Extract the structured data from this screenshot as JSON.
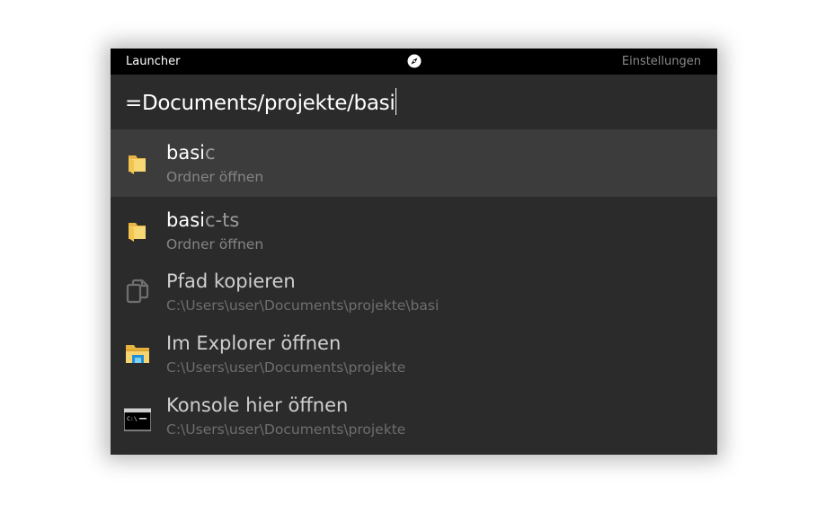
{
  "window": {
    "title": "Launcher",
    "settings_label": "Einstellungen",
    "center_icon": "compass-icon"
  },
  "search": {
    "query": "=Documents/projekte/basi"
  },
  "results": [
    {
      "icon": "folder-icon",
      "title_match": "basi",
      "title_rest": "c",
      "subtitle": "Ordner öffnen",
      "selected": true
    },
    {
      "icon": "folder-icon",
      "title_match": "basi",
      "title_rest": "c-ts",
      "subtitle": "Ordner öffnen",
      "selected": false
    },
    {
      "icon": "copy-icon",
      "title": "Pfad kopieren",
      "subtitle": "C:\\Users\\user\\Documents\\projekte\\basi",
      "selected": false
    },
    {
      "icon": "file-explorer-icon",
      "title": "Im Explorer öffnen",
      "subtitle": "C:\\Users\\user\\Documents\\projekte",
      "selected": false
    },
    {
      "icon": "console-icon",
      "title": "Konsole hier öffnen",
      "subtitle": "C:\\Users\\user\\Documents\\projekte",
      "selected": false
    }
  ],
  "colors": {
    "background": "#2b2b2b",
    "titlebar": "#000000",
    "selected_row": "#3c3c3c",
    "folder_yellow": "#f5c95b"
  }
}
